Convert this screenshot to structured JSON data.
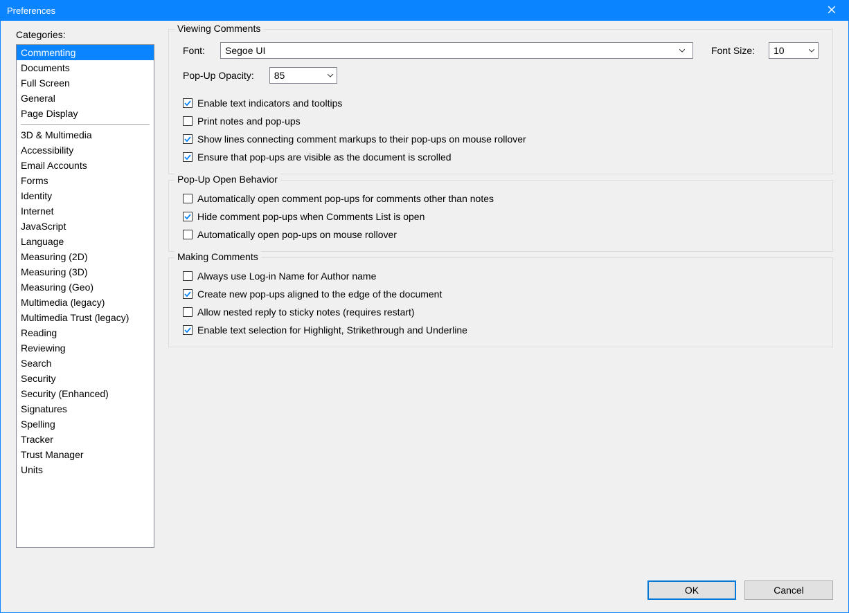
{
  "window": {
    "title": "Preferences"
  },
  "sidebar": {
    "label": "Categories:",
    "groupA": [
      "Commenting",
      "Documents",
      "Full Screen",
      "General",
      "Page Display"
    ],
    "groupB": [
      "3D & Multimedia",
      "Accessibility",
      "Email Accounts",
      "Forms",
      "Identity",
      "Internet",
      "JavaScript",
      "Language",
      "Measuring (2D)",
      "Measuring (3D)",
      "Measuring (Geo)",
      "Multimedia (legacy)",
      "Multimedia Trust (legacy)",
      "Reading",
      "Reviewing",
      "Search",
      "Security",
      "Security (Enhanced)",
      "Signatures",
      "Spelling",
      "Tracker",
      "Trust Manager",
      "Units"
    ],
    "selected": "Commenting"
  },
  "viewing": {
    "title": "Viewing Comments",
    "fontLabel": "Font:",
    "fontValue": "Segoe UI",
    "fontSizeLabel": "Font Size:",
    "fontSizeValue": "10",
    "opacityLabel": "Pop-Up Opacity:",
    "opacityValue": "85",
    "cb": [
      {
        "label": "Enable text indicators and tooltips",
        "checked": true
      },
      {
        "label": "Print notes and pop-ups",
        "checked": false
      },
      {
        "label": "Show lines connecting comment markups to their pop-ups on mouse rollover",
        "checked": true
      },
      {
        "label": "Ensure that pop-ups are visible as the document is scrolled",
        "checked": true
      }
    ]
  },
  "popup": {
    "title": "Pop-Up Open Behavior",
    "cb": [
      {
        "label": "Automatically open comment pop-ups for comments other than notes",
        "checked": false
      },
      {
        "label": "Hide comment pop-ups when Comments List is open",
        "checked": true
      },
      {
        "label": "Automatically open pop-ups on mouse rollover",
        "checked": false
      }
    ]
  },
  "making": {
    "title": "Making Comments",
    "cb": [
      {
        "label": "Always use Log-in Name for Author name",
        "checked": false
      },
      {
        "label": "Create new pop-ups aligned to the edge of the document",
        "checked": true
      },
      {
        "label": "Allow nested reply to sticky notes (requires restart)",
        "checked": false
      },
      {
        "label": "Enable text selection for Highlight, Strikethrough and Underline",
        "checked": true
      }
    ]
  },
  "buttons": {
    "ok": "OK",
    "cancel": "Cancel"
  }
}
